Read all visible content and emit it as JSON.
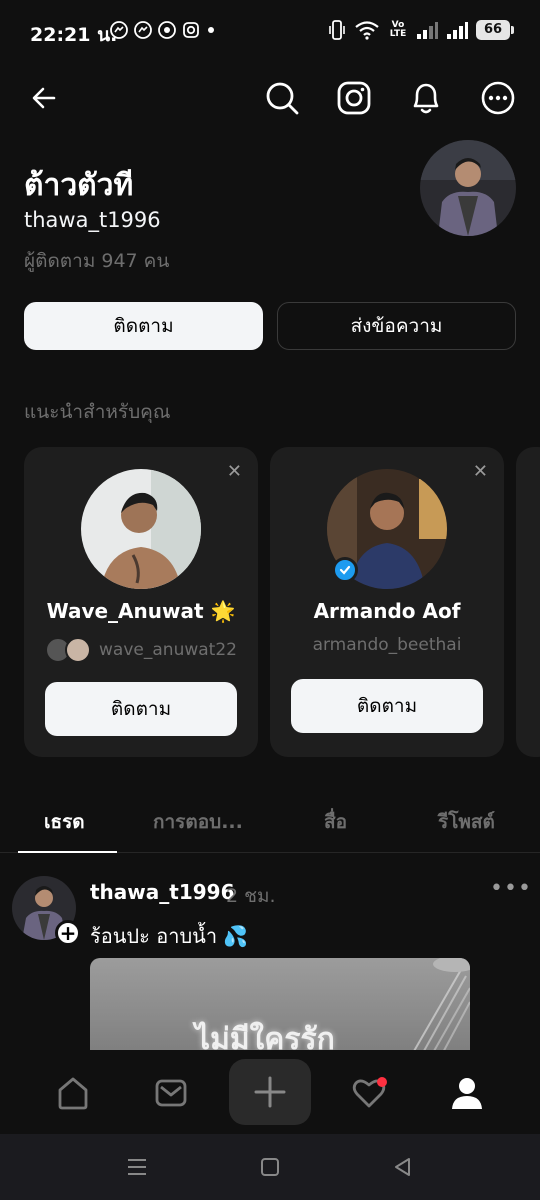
{
  "status_bar": {
    "time": "22:21 น.",
    "network_label_top": "Vo",
    "network_label_bottom": "LTE",
    "battery": "66"
  },
  "top_nav": {
    "icons": [
      "back-arrow-icon",
      "search-icon",
      "instagram-icon",
      "bell-icon",
      "more-options-icon"
    ]
  },
  "profile": {
    "display_name": "ต้าวตัวที",
    "username": "thawa_t1996",
    "followers_text": "ผู้ติดตาม 947 คน",
    "follow_label": "ติดตาม",
    "message_label": "ส่งข้อความ"
  },
  "suggestions": {
    "title": "แนะนำสำหรับคุณ",
    "cards": [
      {
        "name": "Wave_Anuwat 🌟",
        "username": "wave_anuwat22",
        "button": "ติดตาม",
        "verified": false,
        "has_mutual_avatars": true
      },
      {
        "name": "Armando Aof",
        "username": "armando_beethai",
        "button": "ติดตาม",
        "verified": true,
        "has_mutual_avatars": false
      }
    ]
  },
  "tabs": [
    {
      "label": "เธรด",
      "active": true
    },
    {
      "label": "การตอบ...",
      "active": false
    },
    {
      "label": "สื่อ",
      "active": false
    },
    {
      "label": "รีโพสต์",
      "active": false
    }
  ],
  "post": {
    "username": "thawa_t1996",
    "time": "2 ชม.",
    "text": "ร้อนปะ อาบน้ำ 💦",
    "image_text": "ไม่มีใครรัก"
  },
  "colors": {
    "background": "#101010",
    "card": "#1e1e1e",
    "muted_text": "#6e6e6e",
    "notification_dot": "#ff3040",
    "verified": "#1d9bf0"
  }
}
